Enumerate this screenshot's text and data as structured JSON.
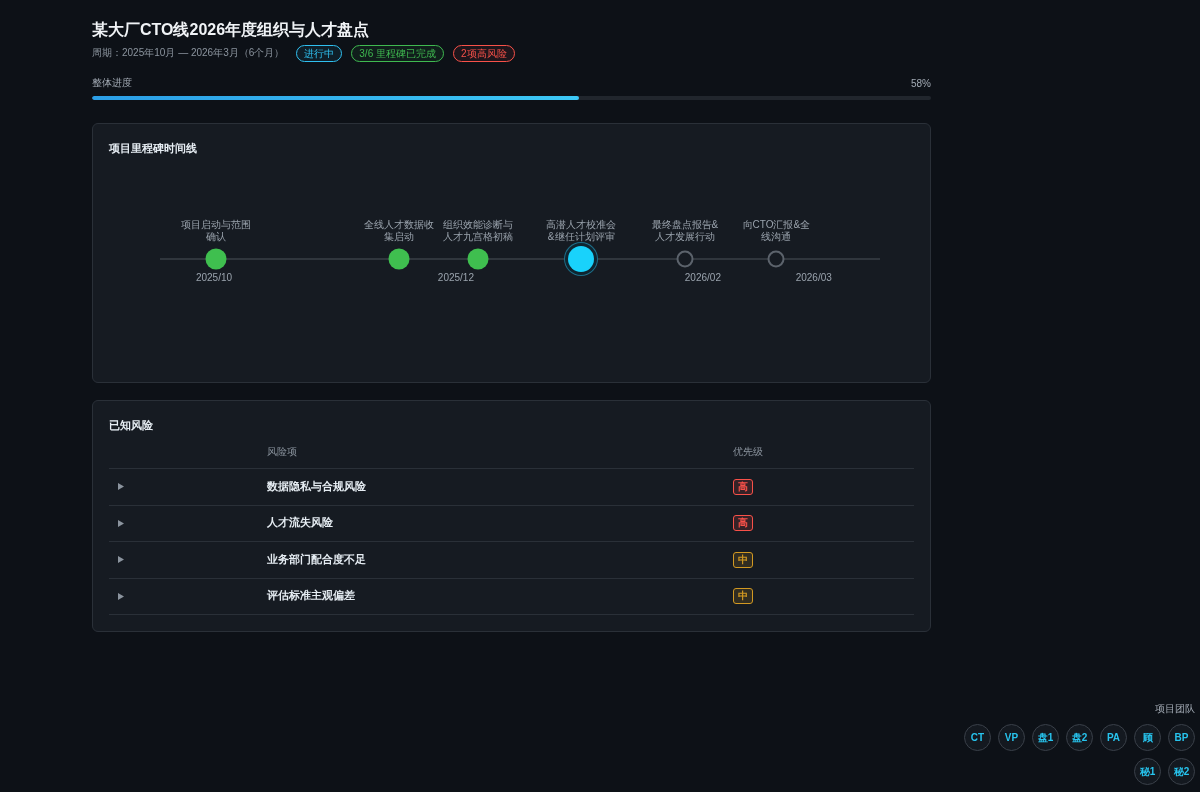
{
  "header": {
    "title": "某大厂CTO线2026年度组织与人才盘点",
    "period": "周期：2025年10月 — 2026年3月（6个月）",
    "badges": [
      {
        "label": "进行中",
        "color": "#2fc0f0"
      },
      {
        "label": "3/6 里程碑已完成",
        "color": "#3fb950"
      },
      {
        "label": "2项高风险",
        "color": "#f85149"
      }
    ]
  },
  "progress": {
    "label": "整体进度",
    "reading": "58%",
    "level": 0.58
  },
  "timeline": {
    "title": "项目里程碑时间线",
    "milestones": [
      {
        "label": "项目启动与范围确认",
        "done": true,
        "current": false
      },
      {
        "label": "全线人才数据收集启动",
        "done": true,
        "current": false
      },
      {
        "label": "组织效能诊断与人才九宫格初稿",
        "done": true,
        "current": false
      },
      {
        "label": "高潜人才校准会&继任计划评审",
        "done": false,
        "current": true
      },
      {
        "label": "最终盘点报告&人才发展行动",
        "done": false,
        "current": false
      },
      {
        "label": "向CTO汇报&全线沟通",
        "done": false,
        "current": false
      }
    ],
    "ticks": [
      "2025/10",
      "2025/12",
      "2026/02",
      "2026/03"
    ]
  },
  "risks": {
    "title": "已知风险",
    "columns": [
      "风险项",
      "优先级"
    ],
    "rows": [
      {
        "name": "数据隐私与合规风险",
        "priority": "高",
        "color": "#f85149",
        "expanded": false
      },
      {
        "name": "人才流失风险",
        "priority": "高",
        "color": "#f85149",
        "expanded": false
      },
      {
        "name": "业务部门配合度不足",
        "priority": "中",
        "color": "#d29922",
        "expanded": false
      },
      {
        "name": "评估标准主观偏差",
        "priority": "中",
        "color": "#d29922",
        "expanded": false
      }
    ]
  },
  "team": {
    "title": "项目团队",
    "members": [
      "CT",
      "VP",
      "盘1",
      "盘2",
      "PA",
      "顾",
      "BP",
      "秘1",
      "秘2"
    ]
  }
}
